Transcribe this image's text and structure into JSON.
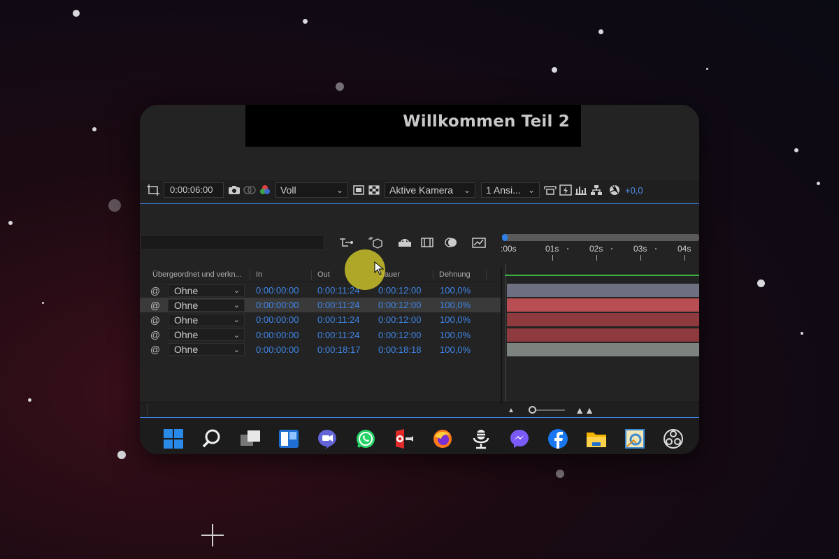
{
  "viewer": {
    "video_title": "Willkommen Teil 2",
    "timecode": "0:00:06:00",
    "resolution": "Voll",
    "camera": "Aktive Kamera",
    "views": "1 Ansi...",
    "exposure": "+0,0"
  },
  "timeline": {
    "ruler_labels": [
      ":00s",
      "01s",
      "02s",
      "03s",
      "04s"
    ],
    "columns": {
      "parent": "Übergeordnet und verkn...",
      "in": "In",
      "out": "Out",
      "duration": "Dauer",
      "stretch": "Dehnung"
    },
    "rows": [
      {
        "parent": "Ohne",
        "in": "0:00:00:00",
        "out": "0:00:11:24",
        "duration": "0:00:12:00",
        "stretch": "100,0%",
        "track_color": "#6e6f80"
      },
      {
        "parent": "Ohne",
        "in": "0:00:00:00",
        "out": "0:00:11:24",
        "duration": "0:00:12:00",
        "stretch": "100,0%",
        "track_color": "#b84e53"
      },
      {
        "parent": "Ohne",
        "in": "0:00:00:00",
        "out": "0:00:11:24",
        "duration": "0:00:12:00",
        "stretch": "100,0%",
        "track_color": "#8e3a3e"
      },
      {
        "parent": "Ohne",
        "in": "0:00:00:00",
        "out": "0:00:11:24",
        "duration": "0:00:12:00",
        "stretch": "100,0%",
        "track_color": "#8e3a3e"
      },
      {
        "parent": "Ohne",
        "in": "0:00:00:00",
        "out": "0:00:18:17",
        "duration": "0:00:18:18",
        "stretch": "100,0%",
        "track_color": "#7c837e"
      }
    ]
  },
  "taskbar": {
    "icons": [
      "windows-start-icon",
      "search-icon",
      "task-view-icon",
      "widgets-icon",
      "teams-chat-icon",
      "whatsapp-icon",
      "screen-recorder-icon",
      "firefox-icon",
      "podcast-mic-icon",
      "messenger-icon",
      "facebook-icon",
      "file-explorer-icon",
      "image-app-icon",
      "obs-studio-icon"
    ]
  },
  "colors": {
    "accent_blue": "#3f86e8",
    "cursor_highlight": "#c8be28"
  }
}
